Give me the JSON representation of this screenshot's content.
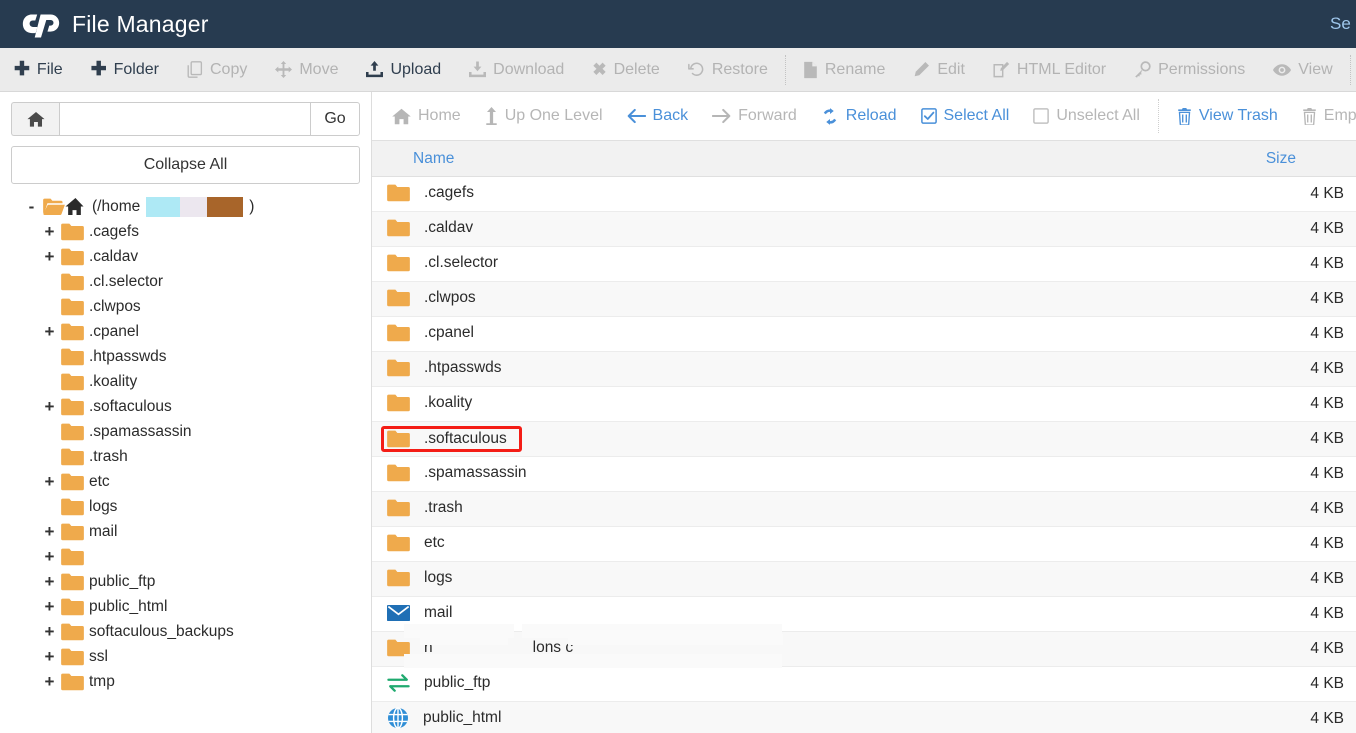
{
  "header": {
    "app_title": "File Manager",
    "logo_icon": "cpanel-logo-icon",
    "search_label": "Se"
  },
  "main_toolbar": {
    "buttons": [
      {
        "label": "File",
        "icon": "plus-icon",
        "disabled": false
      },
      {
        "label": "Folder",
        "icon": "plus-icon",
        "disabled": false
      },
      {
        "label": "Copy",
        "icon": "copy-icon",
        "disabled": true
      },
      {
        "label": "Move",
        "icon": "move-icon",
        "disabled": true
      },
      {
        "label": "Upload",
        "icon": "upload-icon",
        "disabled": false
      },
      {
        "label": "Download",
        "icon": "download-icon",
        "disabled": true
      },
      {
        "label": "Delete",
        "icon": "delete-x-icon",
        "disabled": true
      },
      {
        "label": "Restore",
        "icon": "restore-icon",
        "disabled": true
      },
      {
        "label": "Rename",
        "icon": "file-icon",
        "disabled": true
      },
      {
        "label": "Edit",
        "icon": "pencil-icon",
        "disabled": true
      },
      {
        "label": "HTML Editor",
        "icon": "html-editor-icon",
        "disabled": true
      },
      {
        "label": "Permissions",
        "icon": "key-icon",
        "disabled": true
      },
      {
        "label": "View",
        "icon": "eye-icon",
        "disabled": true
      },
      {
        "label": "",
        "icon": "extract-icon",
        "disabled": true
      }
    ]
  },
  "sidebar": {
    "path_input_value": "",
    "path_input_placeholder": "",
    "home_button_icon": "home-icon",
    "go_label": "Go",
    "collapse_all_label": "Collapse All",
    "tree": [
      {
        "label": "(/home",
        "toggle": "-",
        "depth": 0,
        "icon": "open-folder-home-icon",
        "redacted": true,
        "suffix": ")"
      },
      {
        "label": ".cagefs",
        "toggle": "+",
        "depth": 1,
        "icon": "folder-icon"
      },
      {
        "label": ".caldav",
        "toggle": "+",
        "depth": 1,
        "icon": "folder-icon"
      },
      {
        "label": ".cl.selector",
        "toggle": "",
        "depth": 1,
        "icon": "folder-icon"
      },
      {
        "label": ".clwpos",
        "toggle": "",
        "depth": 1,
        "icon": "folder-icon"
      },
      {
        "label": ".cpanel",
        "toggle": "+",
        "depth": 1,
        "icon": "folder-icon"
      },
      {
        "label": ".htpasswds",
        "toggle": "",
        "depth": 1,
        "icon": "folder-icon"
      },
      {
        "label": ".koality",
        "toggle": "",
        "depth": 1,
        "icon": "folder-icon"
      },
      {
        "label": ".softaculous",
        "toggle": "+",
        "depth": 1,
        "icon": "folder-icon"
      },
      {
        "label": ".spamassassin",
        "toggle": "",
        "depth": 1,
        "icon": "folder-icon"
      },
      {
        "label": ".trash",
        "toggle": "",
        "depth": 1,
        "icon": "folder-icon"
      },
      {
        "label": "etc",
        "toggle": "+",
        "depth": 1,
        "icon": "folder-icon"
      },
      {
        "label": "logs",
        "toggle": "",
        "depth": 1,
        "icon": "folder-icon"
      },
      {
        "label": "mail",
        "toggle": "+",
        "depth": 1,
        "icon": "folder-icon"
      },
      {
        "label": "",
        "toggle": "+",
        "depth": 1,
        "icon": "folder-icon"
      },
      {
        "label": "public_ftp",
        "toggle": "+",
        "depth": 1,
        "icon": "folder-icon"
      },
      {
        "label": "public_html",
        "toggle": "+",
        "depth": 1,
        "icon": "folder-icon"
      },
      {
        "label": "softaculous_backups",
        "toggle": "+",
        "depth": 1,
        "icon": "folder-icon"
      },
      {
        "label": "ssl",
        "toggle": "+",
        "depth": 1,
        "icon": "folder-icon"
      },
      {
        "label": "tmp",
        "toggle": "+",
        "depth": 1,
        "icon": "folder-icon"
      }
    ]
  },
  "list_toolbar": {
    "buttons": [
      {
        "label": "Home",
        "icon": "home-icon",
        "disabled": true
      },
      {
        "label": "Up One Level",
        "icon": "up-arrow-icon",
        "disabled": true
      },
      {
        "label": "Back",
        "icon": "arrow-left-icon",
        "disabled": false
      },
      {
        "label": "Forward",
        "icon": "arrow-right-icon",
        "disabled": true
      },
      {
        "label": "Reload",
        "icon": "reload-icon",
        "disabled": false
      },
      {
        "label": "Select All",
        "icon": "checked-box-icon",
        "disabled": false
      },
      {
        "label": "Unselect All",
        "icon": "unchecked-box-icon",
        "disabled": true
      },
      {
        "label": "View Trash",
        "icon": "trash-icon",
        "disabled": false
      },
      {
        "label": "Empty",
        "icon": "trash-icon",
        "disabled": true
      }
    ]
  },
  "file_table": {
    "columns": {
      "name": "Name",
      "size": "Size"
    },
    "rows": [
      {
        "name": ".cagefs",
        "size": "4 KB",
        "icon": "folder-icon",
        "highlighted": false
      },
      {
        "name": ".caldav",
        "size": "4 KB",
        "icon": "folder-icon",
        "highlighted": false
      },
      {
        "name": ".cl.selector",
        "size": "4 KB",
        "icon": "folder-icon",
        "highlighted": false
      },
      {
        "name": ".clwpos",
        "size": "4 KB",
        "icon": "folder-icon",
        "highlighted": false
      },
      {
        "name": ".cpanel",
        "size": "4 KB",
        "icon": "folder-icon",
        "highlighted": false
      },
      {
        "name": ".htpasswds",
        "size": "4 KB",
        "icon": "folder-icon",
        "highlighted": false
      },
      {
        "name": ".koality",
        "size": "4 KB",
        "icon": "folder-icon",
        "highlighted": false
      },
      {
        "name": ".softaculous",
        "size": "4 KB",
        "icon": "folder-icon",
        "highlighted": true
      },
      {
        "name": ".spamassassin",
        "size": "4 KB",
        "icon": "folder-icon",
        "highlighted": false
      },
      {
        "name": ".trash",
        "size": "4 KB",
        "icon": "folder-icon",
        "highlighted": false
      },
      {
        "name": "etc",
        "size": "4 KB",
        "icon": "folder-icon",
        "highlighted": false
      },
      {
        "name": "logs",
        "size": "4 KB",
        "icon": "folder-icon",
        "highlighted": false
      },
      {
        "name": "mail",
        "size": "4 KB",
        "icon": "mail-icon",
        "highlighted": false
      },
      {
        "name": "",
        "size": "4 KB",
        "icon": "folder-icon",
        "highlighted": false,
        "obscured": true,
        "fragment_left": "n",
        "fragment_right": "lons c"
      },
      {
        "name": "public_ftp",
        "size": "4 KB",
        "icon": "exchange-icon",
        "highlighted": false
      },
      {
        "name": "public_html",
        "size": "4 KB",
        "icon": "globe-icon",
        "highlighted": false
      }
    ]
  },
  "colors": {
    "header_bg": "#273b50",
    "toolbar_bg": "#ebebeb",
    "folder_orange": "#efaa4c",
    "link_blue": "#4a90d9",
    "disabled_gray": "#b3b3b3",
    "highlight_red": "#f41d16",
    "mail_blue": "#1f6fb5",
    "exchange_green": "#1faa6f",
    "globe_blue": "#2f8ed6",
    "redact_cyan": "#aee9f5",
    "redact_lavender": "#ece7ef",
    "redact_brown": "#a8652a"
  }
}
